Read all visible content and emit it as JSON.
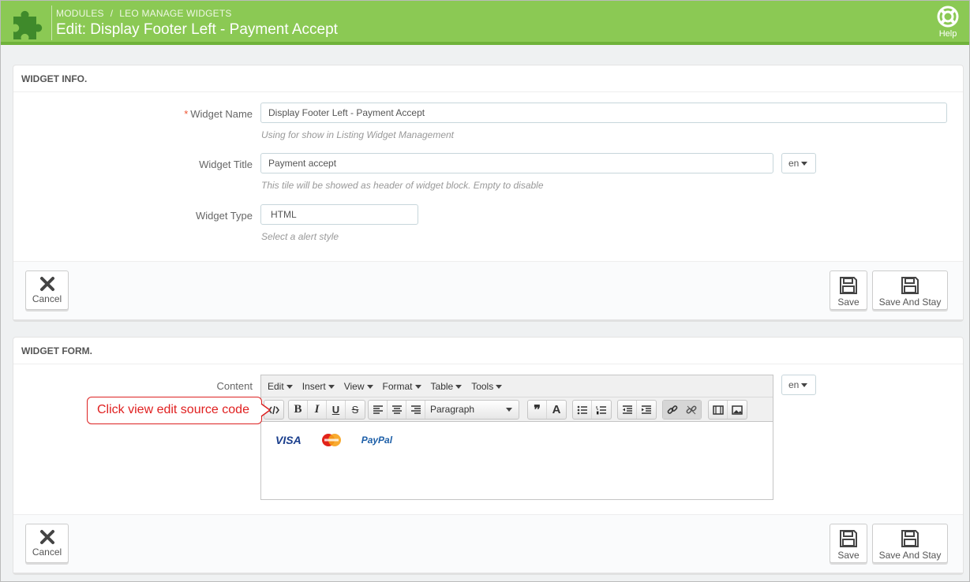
{
  "header": {
    "breadcrumb": [
      "MODULES",
      "LEO MANAGE WIDGETS"
    ],
    "title": "Edit: Display Footer Left - Payment Accept",
    "help_label": "Help"
  },
  "widget_info": {
    "heading": "WIDGET INFO.",
    "name_label": "Widget Name",
    "required_mark": "*",
    "name_value": "Display Footer Left - Payment Accept",
    "name_help": "Using for show in Listing Widget Management",
    "title_label": "Widget Title",
    "title_value": "Payment accept",
    "title_lang": "en",
    "title_help": "This tile will be showed as header of widget block. Empty to disable",
    "type_label": "Widget Type",
    "type_value": "HTML",
    "type_help": "Select a alert style"
  },
  "widget_form": {
    "heading": "WIDGET FORM.",
    "content_label": "Content",
    "content_lang": "en",
    "menu": [
      "Edit",
      "Insert",
      "View",
      "Format",
      "Table",
      "Tools"
    ],
    "block_format": "Paragraph",
    "payment_logos": [
      "VISA",
      "MasterCard",
      "PayPal"
    ]
  },
  "actions": {
    "cancel": "Cancel",
    "save": "Save",
    "save_and_stay": "Save And Stay"
  },
  "callout": "Click view edit source code",
  "colors": {
    "header_green": "#8bc954",
    "accent_red": "#e02020"
  }
}
